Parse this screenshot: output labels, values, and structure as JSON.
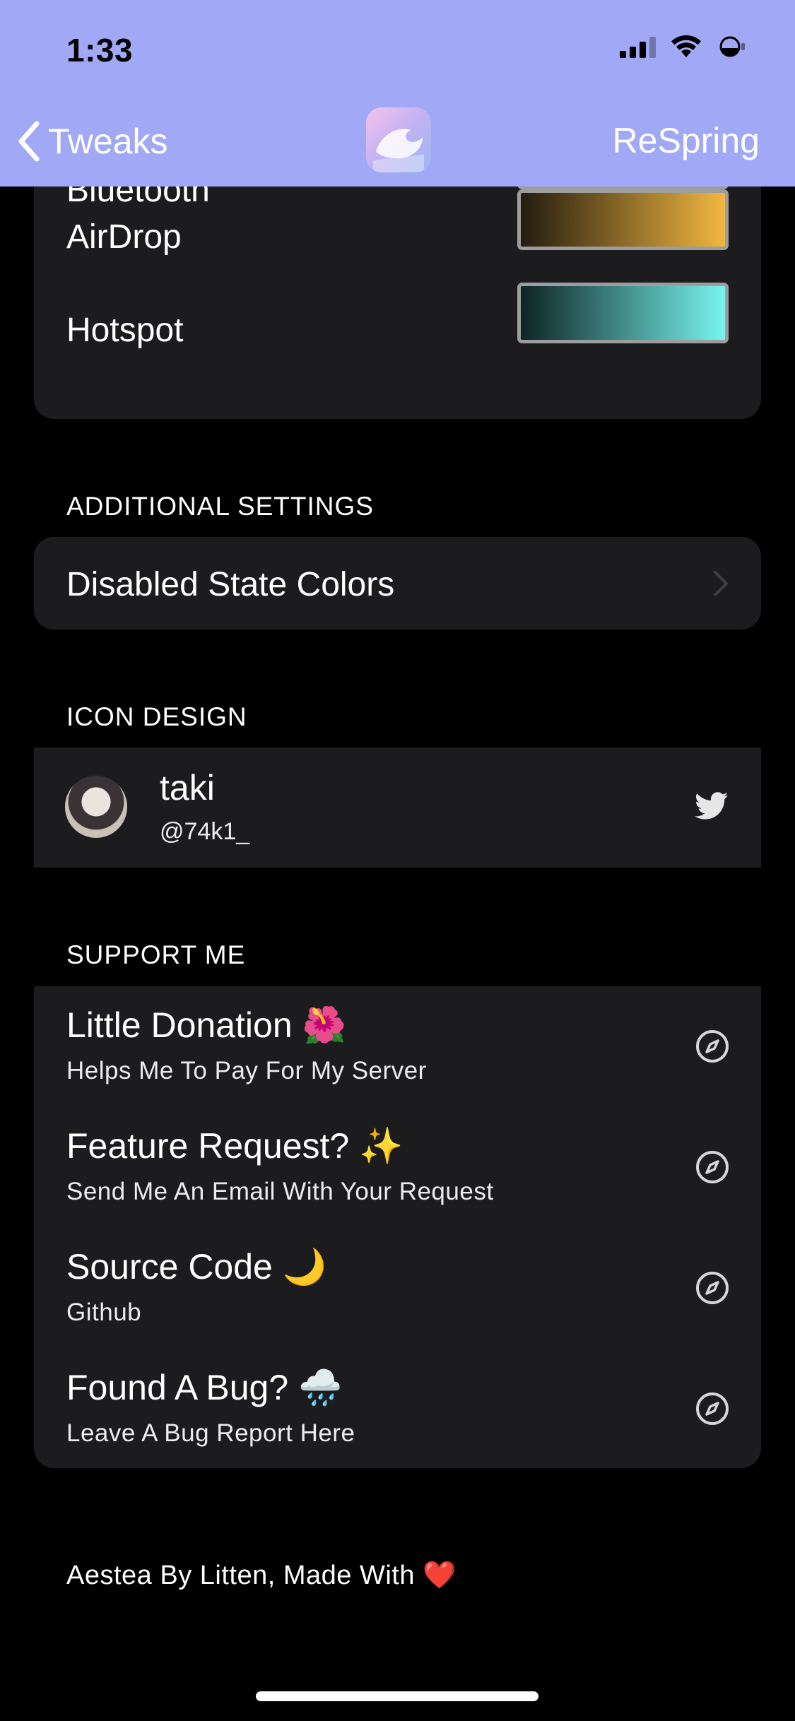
{
  "status_bar": {
    "time": "1:33"
  },
  "nav": {
    "back_label": "Tweaks",
    "action_label": "ReSpring"
  },
  "colors": {
    "nav_bg": "#a1a8f5",
    "cell_bg": "#1c1c1e",
    "bluetooth_swatch": [
      "#2a0f5a",
      "#7c1cf2"
    ],
    "airdrop_swatch": [
      "#231c10",
      "#f2b740"
    ],
    "hotspot_swatch": [
      "#0e2424",
      "#78f4ee"
    ]
  },
  "color_rows": [
    {
      "label": "Bluetooth"
    },
    {
      "label": "AirDrop"
    },
    {
      "label": "Hotspot"
    }
  ],
  "additional": {
    "header": "ADDITIONAL SETTINGS",
    "item": "Disabled State Colors"
  },
  "icon_design": {
    "header": "ICON DESIGN",
    "name": "taki",
    "handle": "@74k1_",
    "icon": "twitter-icon"
  },
  "support": {
    "header": "SUPPORT ME",
    "items": [
      {
        "title": "Little Donation 🌺",
        "subtitle": "Helps Me To Pay For My Server",
        "icon": "compass-icon"
      },
      {
        "title": "Feature Request? ✨",
        "subtitle": "Send Me An Email With Your Request",
        "icon": "compass-icon"
      },
      {
        "title": "Source Code 🌙",
        "subtitle": "Github",
        "icon": "compass-icon"
      },
      {
        "title": "Found A Bug? 🌧️",
        "subtitle": "Leave A Bug Report Here",
        "icon": "compass-icon"
      }
    ]
  },
  "footer": "Aestea By Litten, Made With ❤️"
}
